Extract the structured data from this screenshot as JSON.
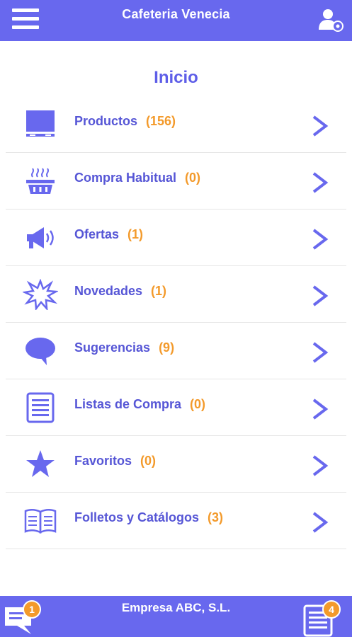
{
  "header": {
    "title": "Cafeteria Venecia",
    "menu_icon": "hamburger-menu-icon",
    "user_icon": "user-settings-icon"
  },
  "page": {
    "title": "Inicio"
  },
  "menu": {
    "items": [
      {
        "label": "Productos",
        "count": "(156)",
        "icon": "monitor-icon"
      },
      {
        "label": "Compra Habitual",
        "count": "(0)",
        "icon": "basket-icon"
      },
      {
        "label": "Ofertas",
        "count": "(1)",
        "icon": "megaphone-icon"
      },
      {
        "label": "Novedades",
        "count": "(1)",
        "icon": "burst-icon"
      },
      {
        "label": "Sugerencias",
        "count": "(9)",
        "icon": "speech-bubble-icon"
      },
      {
        "label": "Listas de Compra",
        "count": "(0)",
        "icon": "list-icon"
      },
      {
        "label": "Favoritos",
        "count": "(0)",
        "icon": "star-icon"
      },
      {
        "label": "Folletos y Catálogos",
        "count": "(3)",
        "icon": "open-book-icon"
      }
    ]
  },
  "footer": {
    "company": "Empresa ABC, S.L.",
    "messages_badge": "1",
    "lists_badge": "4"
  },
  "colors": {
    "primary": "#6868ee",
    "text_primary": "#5656d6",
    "accent_orange": "#f39a2b",
    "background": "#ffffff"
  }
}
